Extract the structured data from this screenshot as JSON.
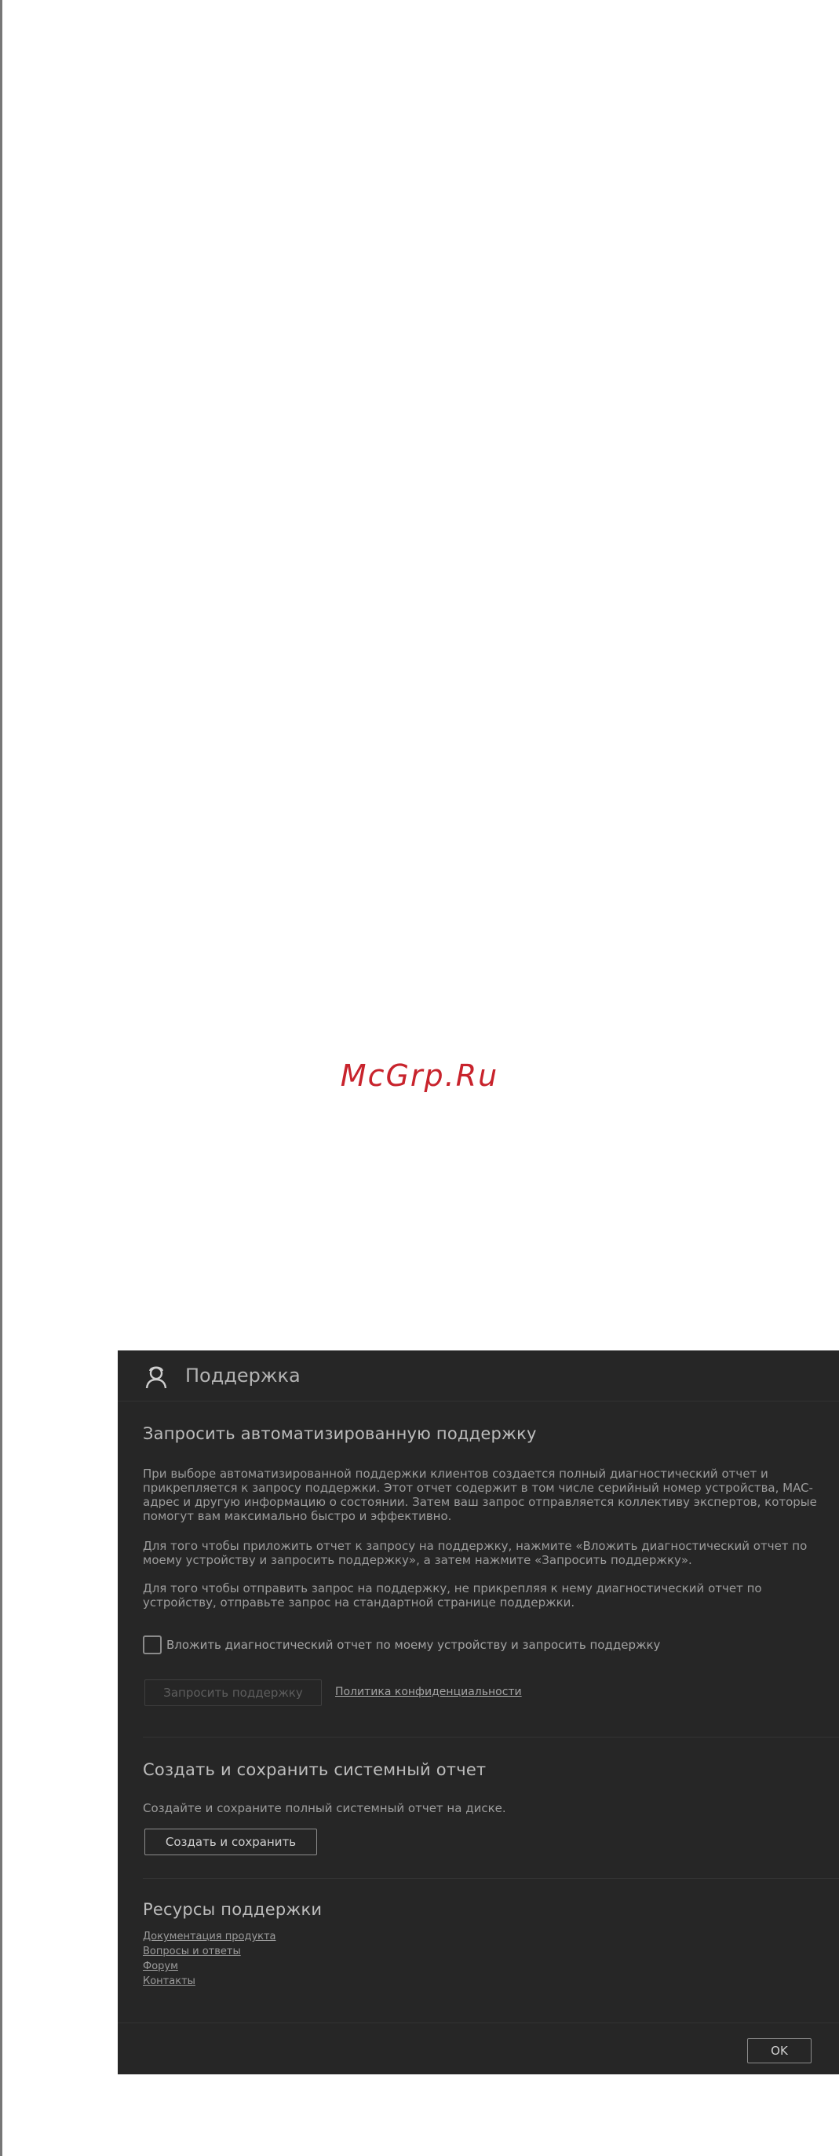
{
  "watermark": "McGrp.Ru",
  "dialog": {
    "title": "Поддержка",
    "icon": "support-person-icon",
    "automated": {
      "title": "Запросить автоматизированную поддержку",
      "p1": "При выборе автоматизированной поддержки клиентов создается полный диагностический отчет и прикрепляется к запросу поддержки. Этот отчет содержит в том числе серийный номер устройства, MAC-адрес и другую информацию о состоянии. Затем ваш запрос отправляется коллективу экспертов, которые помогут вам максимально быстро и эффективно.",
      "p2": "Для того чтобы приложить отчет к запросу на поддержку, нажмите «Вложить диагностический отчет по моему устройству и запросить поддержку», а затем нажмите «Запросить поддержку».",
      "p3": "Для того чтобы отправить запрос на поддержку, не прикрепляя к нему диагностический отчет по устройству, отправьте запрос на стандартной странице поддержки.",
      "checkbox_label": "Вложить диагностический отчет по моему устройству и запросить поддержку",
      "checkbox_checked": false,
      "request_button": "Запросить поддержку",
      "privacy_link": "Политика конфиденциальности"
    },
    "report": {
      "title": "Создать и сохранить системный отчет",
      "description": "Создайте и сохраните полный системный отчет на диске.",
      "button": "Создать и сохранить"
    },
    "resources": {
      "title": "Ресурсы поддержки",
      "links": [
        "Документация продукта",
        "Вопросы и ответы",
        "Форум",
        "Контакты"
      ]
    },
    "ok_button": "OK"
  },
  "colors": {
    "dialog_bg": "#262626",
    "watermark": "#c8232c"
  }
}
